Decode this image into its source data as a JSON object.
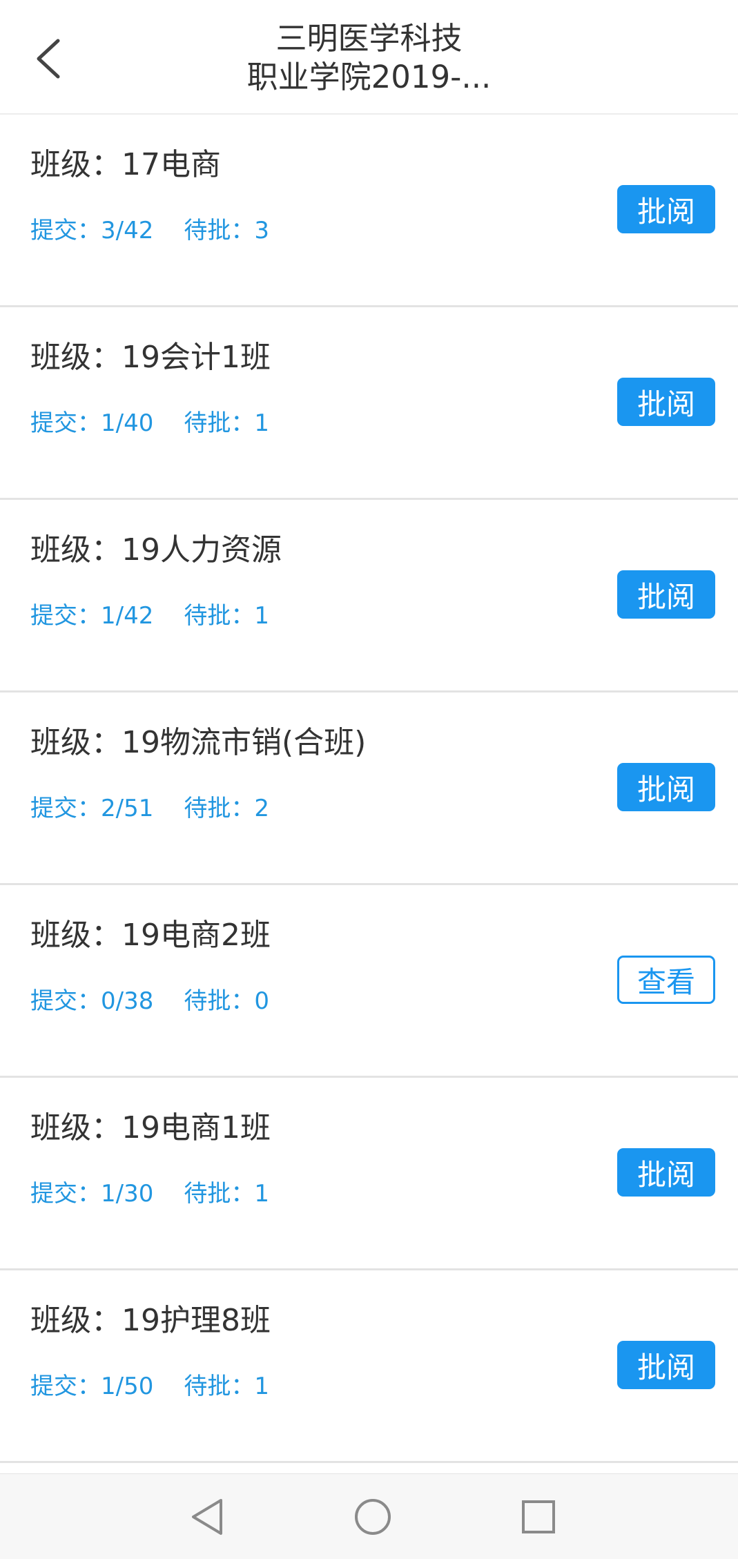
{
  "header": {
    "title_line1": "三明医学科技",
    "title_line2": "职业学院2019-..."
  },
  "rows": [
    {
      "class_label": "班级：17电商",
      "submitted": "提交：3/42",
      "pending": "待批：3",
      "action_label": "批阅",
      "action_style": "filled"
    },
    {
      "class_label": "班级：19会计1班",
      "submitted": "提交：1/40",
      "pending": "待批：1",
      "action_label": "批阅",
      "action_style": "filled"
    },
    {
      "class_label": "班级：19人力资源",
      "submitted": "提交：1/42",
      "pending": "待批：1",
      "action_label": "批阅",
      "action_style": "filled"
    },
    {
      "class_label": "班级：19物流市销(合班)",
      "submitted": "提交：2/51",
      "pending": "待批：2",
      "action_label": "批阅",
      "action_style": "filled"
    },
    {
      "class_label": "班级：19电商2班",
      "submitted": "提交：0/38",
      "pending": "待批：0",
      "action_label": "查看",
      "action_style": "outline"
    },
    {
      "class_label": "班级：19电商1班",
      "submitted": "提交：1/30",
      "pending": "待批：1",
      "action_label": "批阅",
      "action_style": "filled"
    },
    {
      "class_label": "班级：19护理8班",
      "submitted": "提交：1/50",
      "pending": "待批：1",
      "action_label": "批阅",
      "action_style": "filled"
    }
  ],
  "navbar": {
    "icons": [
      "back-triangle-icon",
      "home-circle-icon",
      "recents-square-icon"
    ]
  },
  "colors": {
    "accent": "#1a96f0",
    "stats_text": "#2196e0",
    "divider": "#e3e3e3",
    "text": "#333333"
  }
}
